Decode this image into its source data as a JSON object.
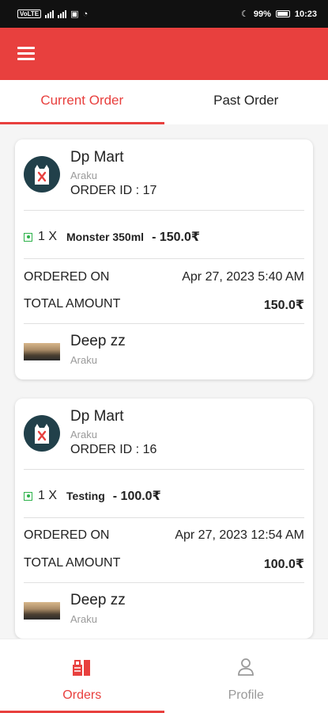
{
  "statusbar": {
    "left_chip": "VoLTE",
    "battery": "99%",
    "time": "10:23"
  },
  "appbar": {
    "menu_icon": "hamburger-icon"
  },
  "tabs": [
    {
      "label": "Current Order",
      "active": true
    },
    {
      "label": "Past Order",
      "active": false
    }
  ],
  "orders": [
    {
      "store_name": "Dp Mart",
      "store_location": "Araku",
      "order_id": "ORDER ID : 17",
      "item_qty": "1 X",
      "item_name": "Monster 350ml",
      "item_price": "- 150.0₹",
      "ordered_on_label": "ORDERED ON",
      "ordered_on_value": "Apr 27, 2023 5:40 AM",
      "total_label": "TOTAL AMOUNT",
      "total_value": "150.0₹",
      "customer_name": "Deep zz",
      "customer_location": "Araku"
    },
    {
      "store_name": "Dp Mart",
      "store_location": "Araku",
      "order_id": "ORDER ID : 16",
      "item_qty": "1 X",
      "item_name": "Testing",
      "item_price": "- 100.0₹",
      "ordered_on_label": "ORDERED ON",
      "ordered_on_value": "Apr 27, 2023 12:54 AM",
      "total_label": "TOTAL AMOUNT",
      "total_value": "100.0₹",
      "customer_name": "Deep zz",
      "customer_location": "Araku"
    }
  ],
  "bottom_nav": [
    {
      "label": "Orders",
      "icon": "orders-icon",
      "active": true
    },
    {
      "label": "Profile",
      "icon": "profile-icon",
      "active": false
    }
  ],
  "colors": {
    "accent": "#e8403e",
    "logo_bg": "#21404a",
    "veg": "#2db24a"
  }
}
